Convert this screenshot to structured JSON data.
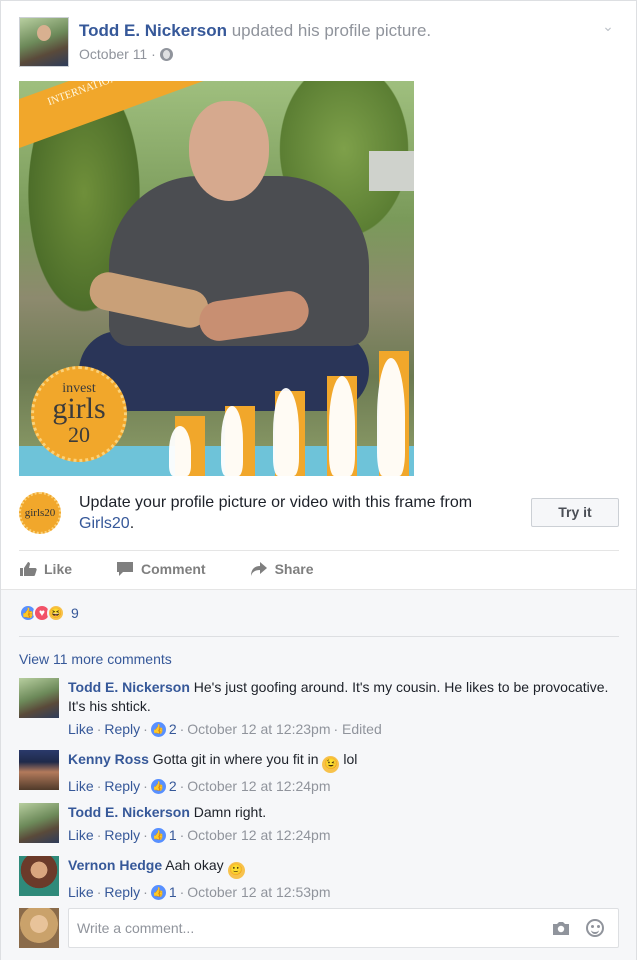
{
  "post": {
    "author": "Todd E. Nickerson",
    "action": " updated his profile picture.",
    "date": "October 11 ·",
    "privacy_icon": "globe-icon",
    "menu_icon": "chevron-down-icon",
    "photo": {
      "banner_text": "INTERNATIONAL DAY OF THE GIRL",
      "badge_line1": "invest",
      "badge_line2": "girls",
      "badge_line3": "20"
    }
  },
  "frame_promo": {
    "text": "Update your profile picture or video with this frame from ",
    "link": "Girls20",
    "suffix": ".",
    "button": "Try it",
    "logo_text": "girls20"
  },
  "actions": {
    "like": "Like",
    "comment": "Comment",
    "share": "Share"
  },
  "reactions": {
    "count": "9",
    "types": [
      "like",
      "love",
      "haha"
    ],
    "colors": {
      "like": "#5890ff",
      "love": "#f25268",
      "haha": "#f7c24c"
    }
  },
  "view_more": "View 11 more comments",
  "comments": [
    {
      "author": "Todd E. Nickerson",
      "text": " He's just goofing around. It's my cousin. He likes to be provocative. It's his shtick.",
      "like": "Like",
      "reply": "Reply",
      "likes": "2",
      "time": "October 12 at 12:23pm",
      "edited": "· Edited"
    },
    {
      "author": "Kenny Ross",
      "text": " Gotta git in where you fit in ",
      "text_after": " lol",
      "like": "Like",
      "reply": "Reply",
      "likes": "2",
      "time": "October 12 at 12:24pm"
    },
    {
      "author": "Todd E. Nickerson",
      "text": " Damn right.",
      "like": "Like",
      "reply": "Reply",
      "likes": "1",
      "time": "October 12 at 12:24pm"
    },
    {
      "author": "Vernon Hedge",
      "text": " Aah okay ",
      "like": "Like",
      "reply": "Reply",
      "likes": "1",
      "time": "October 12 at 12:53pm"
    }
  ],
  "composer": {
    "placeholder": "Write a comment..."
  },
  "colors": {
    "link": "#365899",
    "muted": "#90949c",
    "accent_orange": "#f1a72b"
  }
}
